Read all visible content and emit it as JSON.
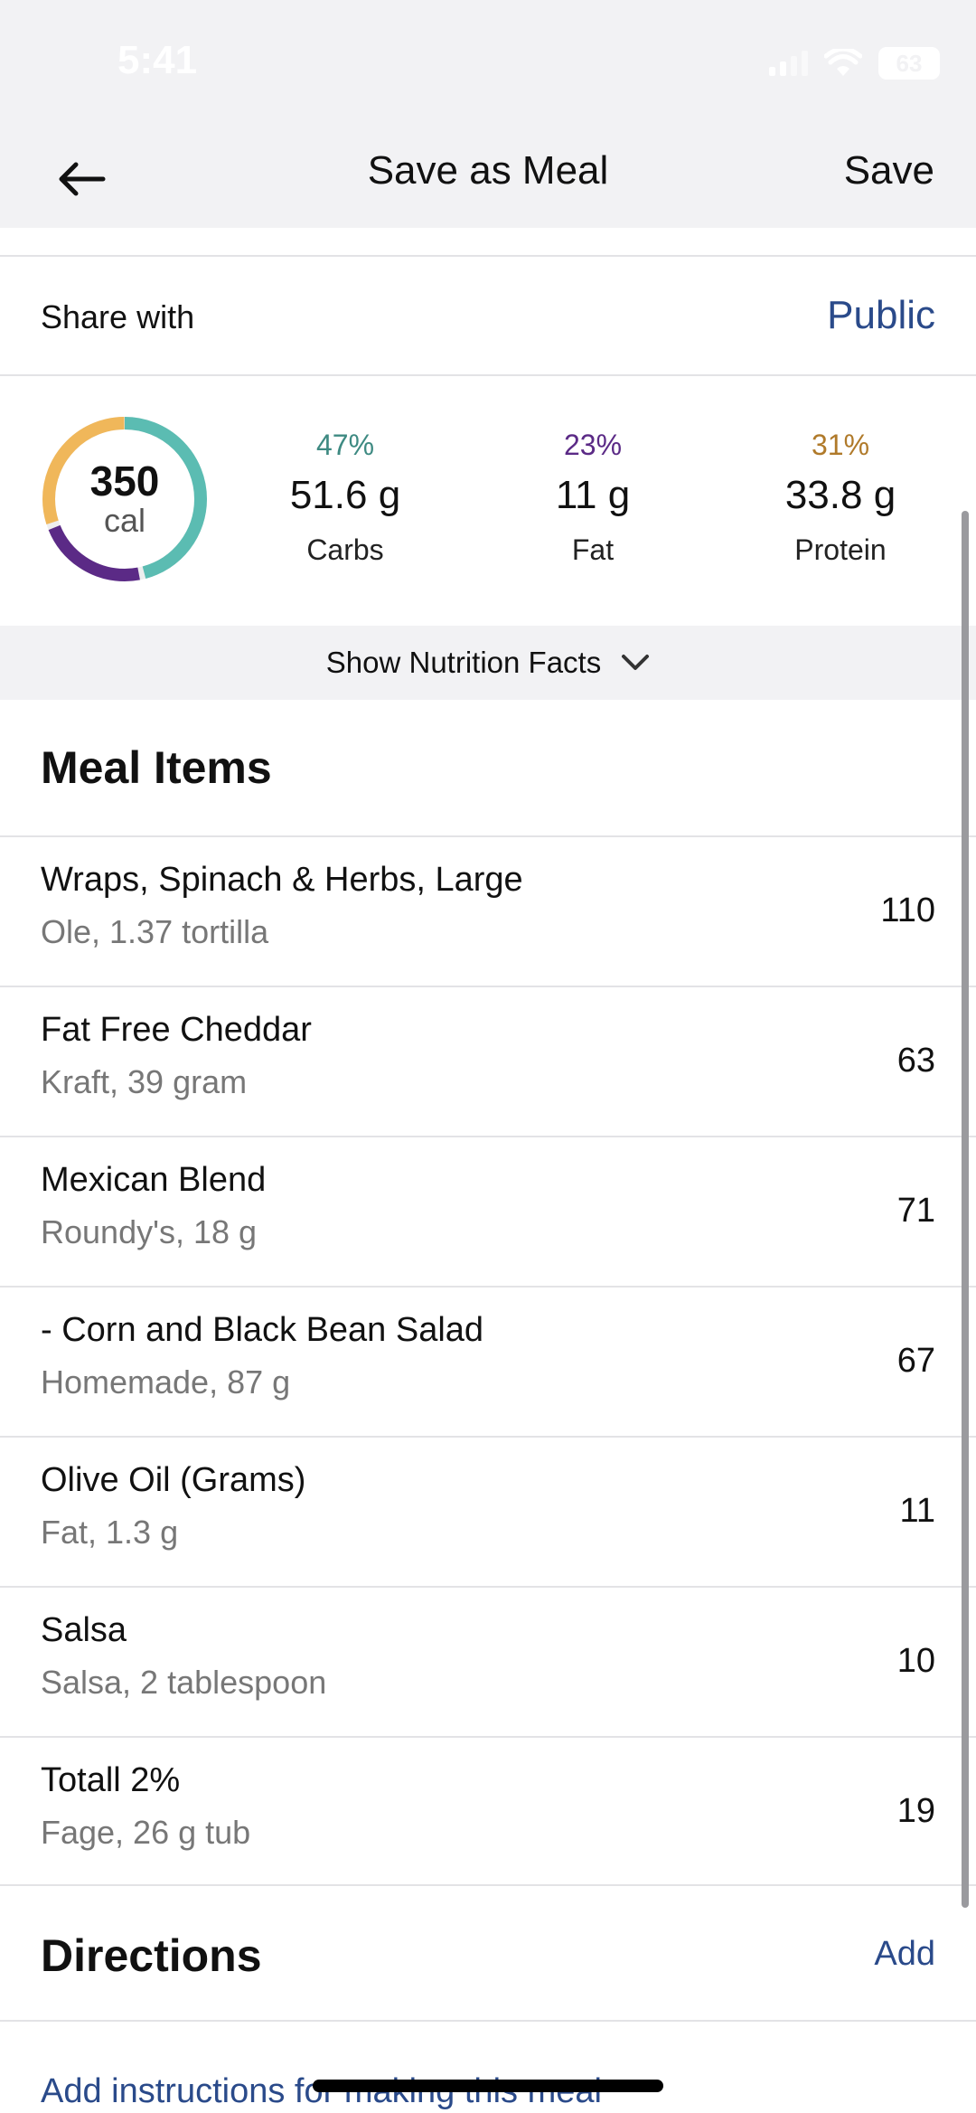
{
  "status_bar": {
    "time": "5:41",
    "battery": "63"
  },
  "nav": {
    "title": "Save as Meal",
    "save_label": "Save"
  },
  "share": {
    "label": "Share with",
    "value": "Public"
  },
  "macros": {
    "calories": "350",
    "calories_unit": "cal",
    "carbs": {
      "percent": "47%",
      "amount": "51.6 g",
      "name": "Carbs",
      "color": "#5bbcb2"
    },
    "fat": {
      "percent": "23%",
      "amount": "11 g",
      "name": "Fat",
      "color": "#5b2a86"
    },
    "protein": {
      "percent": "31%",
      "amount": "33.8 g",
      "name": "Protein",
      "color": "#f0b75a"
    }
  },
  "nutrition_toggle": {
    "label": "Show Nutrition Facts"
  },
  "meal_items": {
    "title": "Meal Items",
    "items": [
      {
        "name": "Wraps, Spinach & Herbs, Large",
        "detail": "Ole, 1.37 tortilla",
        "calories": "110"
      },
      {
        "name": "Fat Free Cheddar",
        "detail": "Kraft, 39 gram",
        "calories": "63"
      },
      {
        "name": "Mexican Blend",
        "detail": "Roundy's, 18 g",
        "calories": "71"
      },
      {
        "name": "- Corn and Black Bean Salad",
        "detail": "Homemade, 87 g",
        "calories": "67"
      },
      {
        "name": "Olive Oil (Grams)",
        "detail": "Fat, 1.3 g",
        "calories": "11"
      },
      {
        "name": "Salsa",
        "detail": "Salsa, 2 tablespoon",
        "calories": "10"
      },
      {
        "name": "Totall 2%",
        "detail": "Fage, 26 g tub",
        "calories": "19"
      }
    ]
  },
  "directions": {
    "title": "Directions",
    "add_label": "Add",
    "hint": "Add instructions for making this meal"
  },
  "colors": {
    "accent_link": "#2a4a8a",
    "nav_background": "#f2f2f4"
  },
  "icons": {
    "back": "arrow-left-icon",
    "toggle": "chevron-down-icon"
  }
}
